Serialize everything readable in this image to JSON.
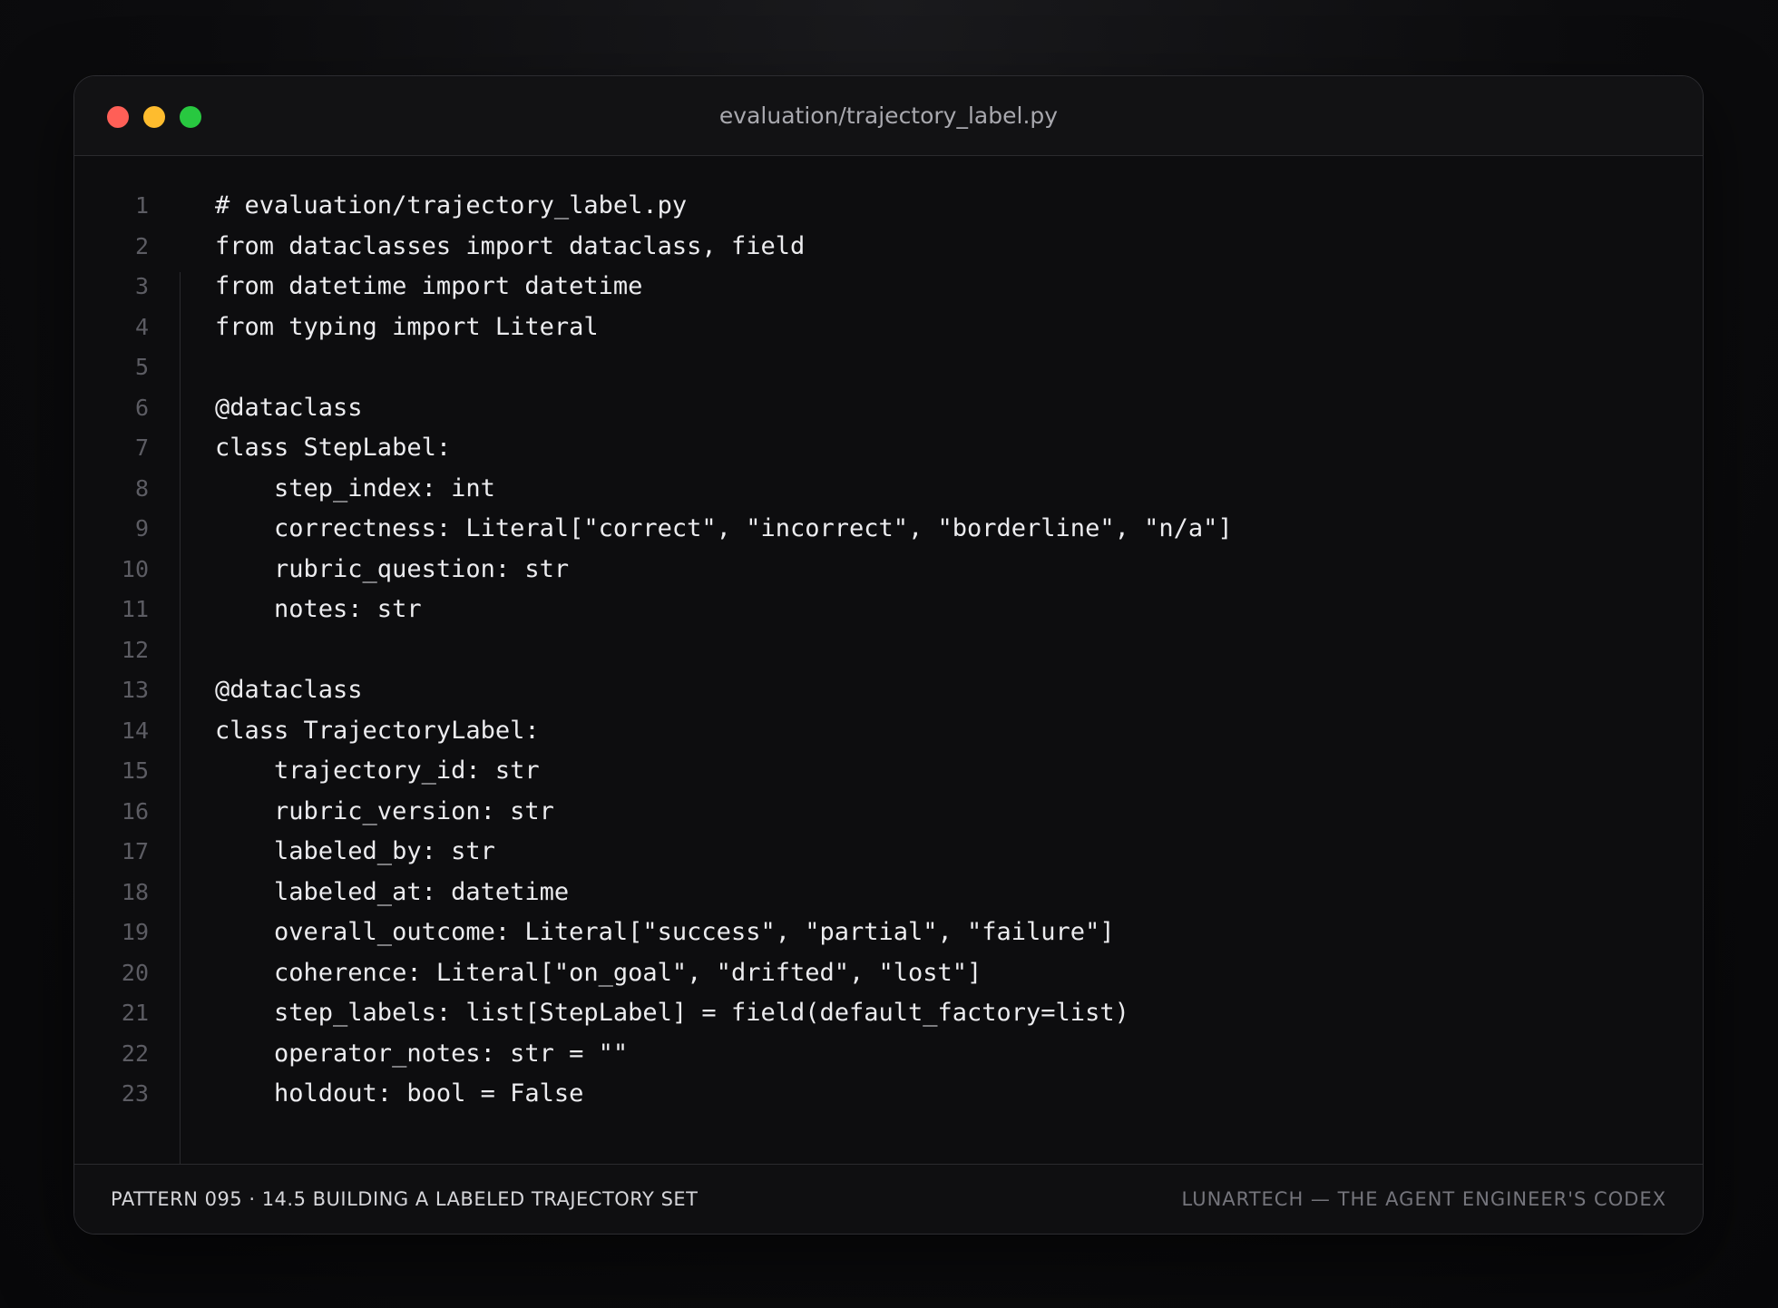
{
  "window": {
    "title": "evaluation/trajectory_label.py",
    "controls": {
      "close_color": "#ff5f57",
      "minimize_color": "#febc2e",
      "maximize_color": "#28c840"
    }
  },
  "code": {
    "lines": [
      {
        "n": "1",
        "text": "# evaluation/trajectory_label.py"
      },
      {
        "n": "2",
        "text": "from dataclasses import dataclass, field"
      },
      {
        "n": "3",
        "text": "from datetime import datetime"
      },
      {
        "n": "4",
        "text": "from typing import Literal"
      },
      {
        "n": "5",
        "text": ""
      },
      {
        "n": "6",
        "text": "@dataclass"
      },
      {
        "n": "7",
        "text": "class StepLabel:"
      },
      {
        "n": "8",
        "text": "    step_index: int"
      },
      {
        "n": "9",
        "text": "    correctness: Literal[\"correct\", \"incorrect\", \"borderline\", \"n/a\"]"
      },
      {
        "n": "10",
        "text": "    rubric_question: str"
      },
      {
        "n": "11",
        "text": "    notes: str"
      },
      {
        "n": "12",
        "text": ""
      },
      {
        "n": "13",
        "text": "@dataclass"
      },
      {
        "n": "14",
        "text": "class TrajectoryLabel:"
      },
      {
        "n": "15",
        "text": "    trajectory_id: str"
      },
      {
        "n": "16",
        "text": "    rubric_version: str"
      },
      {
        "n": "17",
        "text": "    labeled_by: str"
      },
      {
        "n": "18",
        "text": "    labeled_at: datetime"
      },
      {
        "n": "19",
        "text": "    overall_outcome: Literal[\"success\", \"partial\", \"failure\"]"
      },
      {
        "n": "20",
        "text": "    coherence: Literal[\"on_goal\", \"drifted\", \"lost\"]"
      },
      {
        "n": "21",
        "text": "    step_labels: list[StepLabel] = field(default_factory=list)"
      },
      {
        "n": "22",
        "text": "    operator_notes: str = \"\""
      },
      {
        "n": "23",
        "text": "    holdout: bool = False"
      }
    ]
  },
  "footer": {
    "left": "PATTERN 095 · 14.5 BUILDING A LABELED TRAJECTORY SET",
    "right": "LUNARTECH — THE AGENT ENGINEER'S CODEX"
  }
}
